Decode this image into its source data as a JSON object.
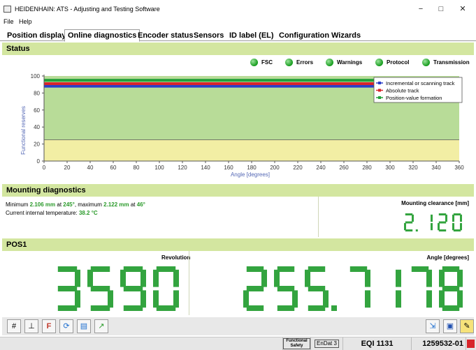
{
  "window": {
    "title": "HEIDENHAIN: ATS - Adjusting and Testing Software",
    "minimize": "−",
    "maximize": "□",
    "close": "✕"
  },
  "menu": [
    "File",
    "Help"
  ],
  "tabs": [
    "Position display",
    "Online diagnostics",
    "Encoder status",
    "Sensors",
    "ID label (EL)",
    "Configuration",
    "Wizards"
  ],
  "status": {
    "title": "Status",
    "indicators": [
      "FSC",
      "Errors",
      "Warnings",
      "Protocol",
      "Transmission"
    ],
    "indicator_color": "#1a9e23"
  },
  "chart_data": {
    "type": "line",
    "ylabel": "Functional reserves",
    "xlabel": "Angle [degrees]",
    "xlim": [
      0,
      360
    ],
    "ylim": [
      0,
      100
    ],
    "xticks": [
      "0",
      "20",
      "40",
      "60",
      "80",
      "100",
      "120",
      "140",
      "160",
      "180",
      "200",
      "220",
      "240",
      "260",
      "280",
      "300",
      "320",
      "340",
      "360"
    ],
    "yticks": [
      "0",
      "20",
      "40",
      "60",
      "80",
      "100"
    ],
    "bands": [
      {
        "from": 0,
        "to": 25,
        "color": "#f2eea4"
      },
      {
        "from": 25,
        "to": 100,
        "color": "#b8dc98"
      }
    ],
    "grid": false,
    "legend_position": "top-right",
    "series": [
      {
        "name": "Incremental or scanning track",
        "color": "#2a3fc8",
        "x": [
          0,
          360
        ],
        "y": [
          88,
          88
        ]
      },
      {
        "name": "Absolute track",
        "color": "#d8242a",
        "x": [
          0,
          360
        ],
        "y": [
          91,
          91
        ]
      },
      {
        "name": "Position-value formation",
        "color": "#23a03a",
        "x": [
          0,
          360
        ],
        "y": [
          95,
          95
        ]
      }
    ]
  },
  "mounting": {
    "title": "Mounting diagnostics",
    "line1": {
      "t1": "Minimum ",
      "v1": "2.106 mm",
      "t2": " at ",
      "v2": "245°",
      "t3": ", maximum ",
      "v3": "2.122 mm",
      "t4": " at ",
      "v4": "46°"
    },
    "line2": {
      "t1": "Current internal temperature: ",
      "v1": "38.2 °C"
    },
    "clearance_label": "Mounting clearance [mm]",
    "clearance_value": "2.120"
  },
  "pos1": {
    "title": "POS1",
    "revolution_label": "Revolution",
    "revolution_value": "3590",
    "angle_label": "Angle [degrees]",
    "angle_value": "255.7178"
  },
  "toolbar": {
    "left_buttons": [
      "grid-icon",
      "axes-icon",
      "fahrenheit-celsius-icon",
      "refresh-icon",
      "export-icon",
      "chart-icon"
    ],
    "right_buttons": [
      "chart-scale-icon",
      "save-icon",
      "wizard-icon"
    ]
  },
  "statusbar": {
    "functional_safety": "Functional Safety",
    "endat": "EnDat 3",
    "encoder": "EQI 1131",
    "serial": "1259532-01"
  }
}
